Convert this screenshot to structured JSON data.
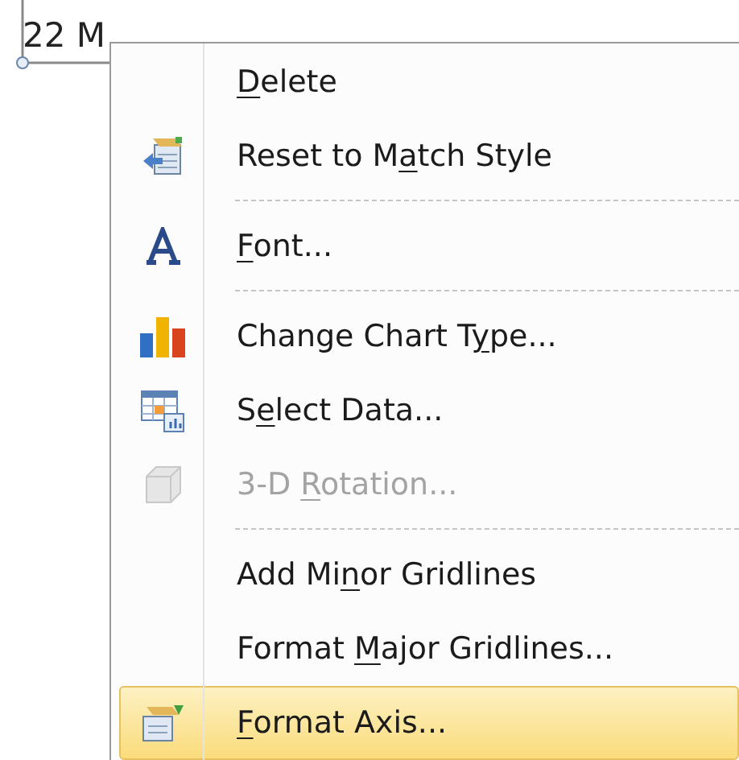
{
  "axis_label": {
    "text": "22 M"
  },
  "context_menu": {
    "items": [
      {
        "kind": "item",
        "access_key": "D",
        "label_end": "elete",
        "disabled": false,
        "selected": false
      },
      {
        "kind": "item",
        "label_start": "Reset to M",
        "access_key": "a",
        "label_end": "tch Style",
        "disabled": false,
        "selected": false
      },
      {
        "kind": "separator"
      },
      {
        "kind": "item",
        "access_key": "F",
        "label_end": "ont...",
        "disabled": false,
        "selected": false
      },
      {
        "kind": "separator"
      },
      {
        "kind": "item",
        "label_start": "Change Chart T",
        "access_key": "y",
        "label_end": "pe...",
        "disabled": false,
        "selected": false
      },
      {
        "kind": "item",
        "label_start": "S",
        "access_key": "e",
        "label_end": "lect Data...",
        "disabled": false,
        "selected": false
      },
      {
        "kind": "item",
        "label_start": "3-D ",
        "access_key": "R",
        "label_end": "otation...",
        "disabled": true,
        "selected": false
      },
      {
        "kind": "separator"
      },
      {
        "kind": "item",
        "label_start": "Add Mi",
        "access_key": "n",
        "label_end": "or Gridlines",
        "disabled": false,
        "selected": false
      },
      {
        "kind": "item",
        "label_start": "Format ",
        "access_key": "M",
        "label_end": "ajor Gridlines...",
        "disabled": false,
        "selected": false
      },
      {
        "kind": "item",
        "access_key": "F",
        "label_end": "ormat Axis...",
        "disabled": false,
        "selected": true
      }
    ]
  }
}
